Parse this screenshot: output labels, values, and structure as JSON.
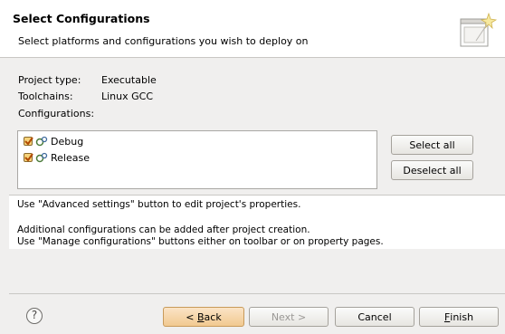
{
  "header": {
    "title": "Select Configurations",
    "description": "Select platforms and configurations you wish to deploy on",
    "icon": "wizard-banner-icon"
  },
  "project_info": {
    "type_label": "Project type:",
    "type_value": "Executable",
    "toolchains_label": "Toolchains:",
    "toolchains_value": "Linux GCC",
    "configurations_label": "Configurations:"
  },
  "configurations": [
    {
      "label": "Debug",
      "checked": true
    },
    {
      "label": "Release",
      "checked": true
    }
  ],
  "list_buttons": {
    "select_all": "Select all",
    "deselect_all": "Deselect all"
  },
  "messages": {
    "line1": "Use \"Advanced settings\" button to edit project's properties.",
    "line2": "Additional configurations can be added after project creation.",
    "line3": "Use \"Manage configurations\" buttons either on toolbar or on property pages."
  },
  "footer": {
    "help": "?",
    "back_mnemonic": "B",
    "back_rest": "ack",
    "back_prefix": "< ",
    "next": "Next >",
    "cancel": "Cancel",
    "finish_mnemonic": "F",
    "finish_rest": "inish"
  }
}
